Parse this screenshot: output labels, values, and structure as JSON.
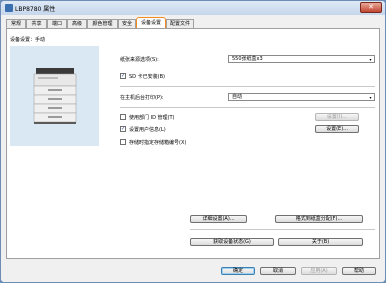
{
  "window": {
    "title": "LBP8780 属性",
    "close_glyph": "✕"
  },
  "tabs": [
    {
      "label": "常规"
    },
    {
      "label": "共享"
    },
    {
      "label": "端口"
    },
    {
      "label": "高级"
    },
    {
      "label": "颜色管理"
    },
    {
      "label": "安全"
    },
    {
      "label": "设备设置"
    },
    {
      "label": "配置文件"
    }
  ],
  "active_tab": "设备设置",
  "device_settings": {
    "header": "设备设置：手动",
    "paper_source_label": "纸张来源选项(S):",
    "paper_source_value": "550张纸盒x3",
    "sd_card_label": "SD 卡已安装(B)",
    "sd_card_checked": true,
    "spool_label": "在主机后台打印(P):",
    "spool_value": "自动",
    "dept_id_label": "使用部门 ID 管理(T)",
    "dept_id_checked": false,
    "user_info_label": "设置用户信息(L)",
    "user_info_checked": true,
    "store_box_label": "存储时指定存储箱编号(X)",
    "store_box_checked": false,
    "settings_btn_disabled": "设置(I)...",
    "settings_btn": "设置(E)...",
    "details_btn": "详细设置(A)...",
    "form_layout_btn": "格式到纸盒分配(F)...",
    "get_status_btn": "获取设备状态(G)",
    "about_btn": "关于(B)"
  },
  "footer": {
    "ok": "确定",
    "cancel": "取消",
    "apply": "应用(A)",
    "help": "帮助"
  },
  "icons": {
    "check": "✓",
    "dropdown": "▾"
  },
  "colors": {
    "active_tab_border": "#f28c1c",
    "illustration_bg": "#d9e8f2"
  }
}
